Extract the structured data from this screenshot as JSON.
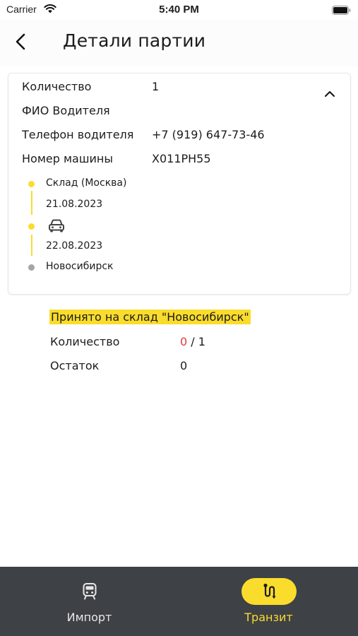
{
  "status_bar": {
    "carrier": "Carrier",
    "time": "5:40 PM"
  },
  "header": {
    "title": "Детали партии"
  },
  "card": {
    "quantity_label": "Количество",
    "quantity_value": "1",
    "driver_name_label": "ФИО Водителя",
    "driver_name_value": "",
    "driver_phone_label": "Телефон водителя",
    "driver_phone_value": "+7 (919) 647-73-46",
    "car_number_label": "Номер машины",
    "car_number_value": "Х011РН55",
    "timeline": {
      "origin": "Склад (Москва)",
      "origin_date": "21.08.2023",
      "transit_date": "22.08.2023",
      "destination": "Новосибирск"
    }
  },
  "accepted": {
    "banner": "Принято на склад \"Новосибирск\"",
    "quantity_label": "Количество",
    "quantity_received": "0",
    "quantity_total": "/ 1",
    "remainder_label": "Остаток",
    "remainder_value": "0"
  },
  "nav": {
    "import_label": "Импорт",
    "transit_label": "Транзит",
    "active": "transit"
  },
  "colors": {
    "accent": "#fadc2c",
    "nav_bg": "#3e4146",
    "alert": "#e53935",
    "inactive_dot": "#a5a5a5"
  }
}
